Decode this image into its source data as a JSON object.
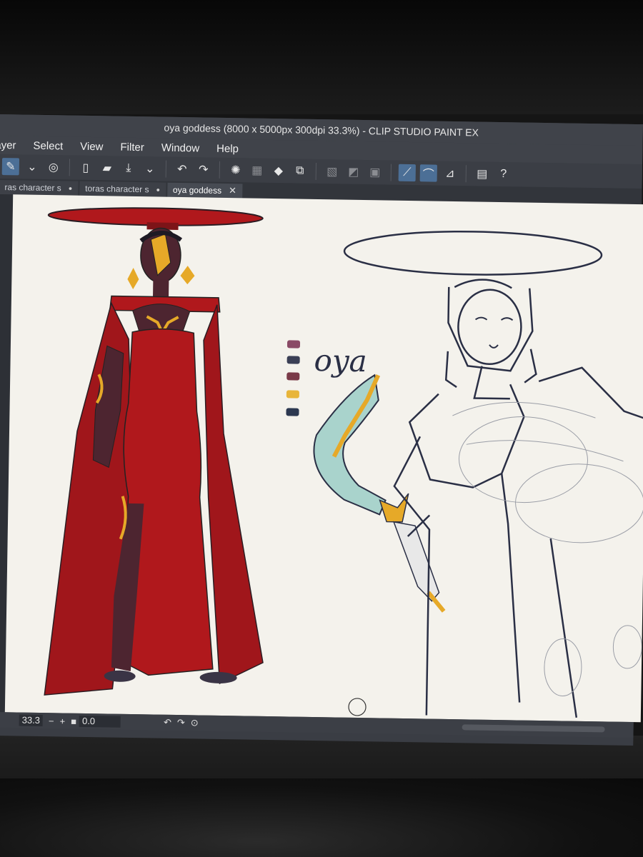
{
  "window": {
    "title": "oya goddess (8000 x 5000px 300dpi 33.3%)  - CLIP STUDIO PAINT EX"
  },
  "menu": [
    "ayer",
    "Select",
    "View",
    "Filter",
    "Window",
    "Help"
  ],
  "toolbar": {
    "icons": [
      "pen-icon",
      "chevron-down-icon",
      "lasso-icon",
      "new-file-icon",
      "open-folder-icon",
      "save-icon",
      "undo-icon",
      "redo-icon",
      "selection-burst-icon",
      "fill-icon",
      "transform-icon",
      "ruler-icon",
      "help-icon"
    ]
  },
  "tabs": [
    {
      "label": "ras character s"
    },
    {
      "label": "toras character s"
    },
    {
      "label": "oya goddess",
      "active": true
    }
  ],
  "canvas": {
    "handwritten_label": "oya",
    "palette_colors": [
      "#8a4a66",
      "#3a3f55",
      "#7a3a48",
      "#e8b53a",
      "#2c3850"
    ]
  },
  "status": {
    "zoom": "33.3",
    "minus": "−",
    "plus": "+",
    "rotation": "0.0"
  },
  "colors": {
    "dress_red": "#b0181c",
    "gold": "#e6a928",
    "skin_shadow": "#4d2530",
    "lineart": "#2a2f45"
  }
}
